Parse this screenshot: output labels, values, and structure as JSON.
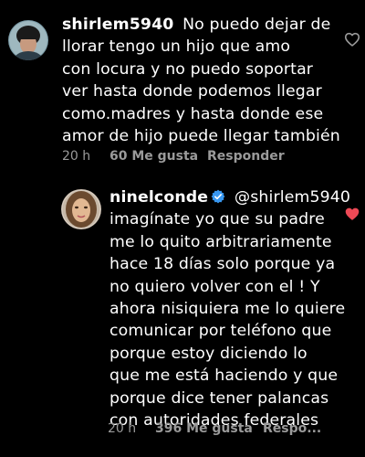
{
  "comments": [
    {
      "username": "shirlem5940",
      "text_lines": [
        "No puedo dejar de",
        "llorar tengo un hijo que amo",
        "con locura y no puedo soportar",
        "ver hasta donde podemos llegar",
        "como.madres y hasta donde ese",
        "amor de hijo puede llegar también"
      ],
      "time": "20 h",
      "likes": "60 Me gusta",
      "reply_label": "Responder",
      "liked": false,
      "heart_icon": "heart-outline-icon"
    },
    {
      "username": "ninelconde",
      "verified": true,
      "mention": "@shirlem5940",
      "text_lines": [
        "imagínate yo que su padre",
        "me lo quito arbitrariamente",
        "hace 18 días solo porque ya",
        "no quiero volver con el ! Y",
        "ahora nisiquiera me lo quiere",
        "comunicar por teléfono que",
        "porque estoy diciendo lo",
        "que me está haciendo y que",
        "porque dice tener palancas",
        "con autoridades federales"
      ],
      "time": "20 h",
      "likes": "396 Me gusta",
      "reply_label": "Respo...",
      "liked": true,
      "heart_icon": "heart-filled-icon"
    }
  ],
  "colors": {
    "background": "#000000",
    "text": "#ffffff",
    "meta": "#9a9a9a",
    "verified": "#3897f0",
    "liked_heart": "#ed4956"
  }
}
